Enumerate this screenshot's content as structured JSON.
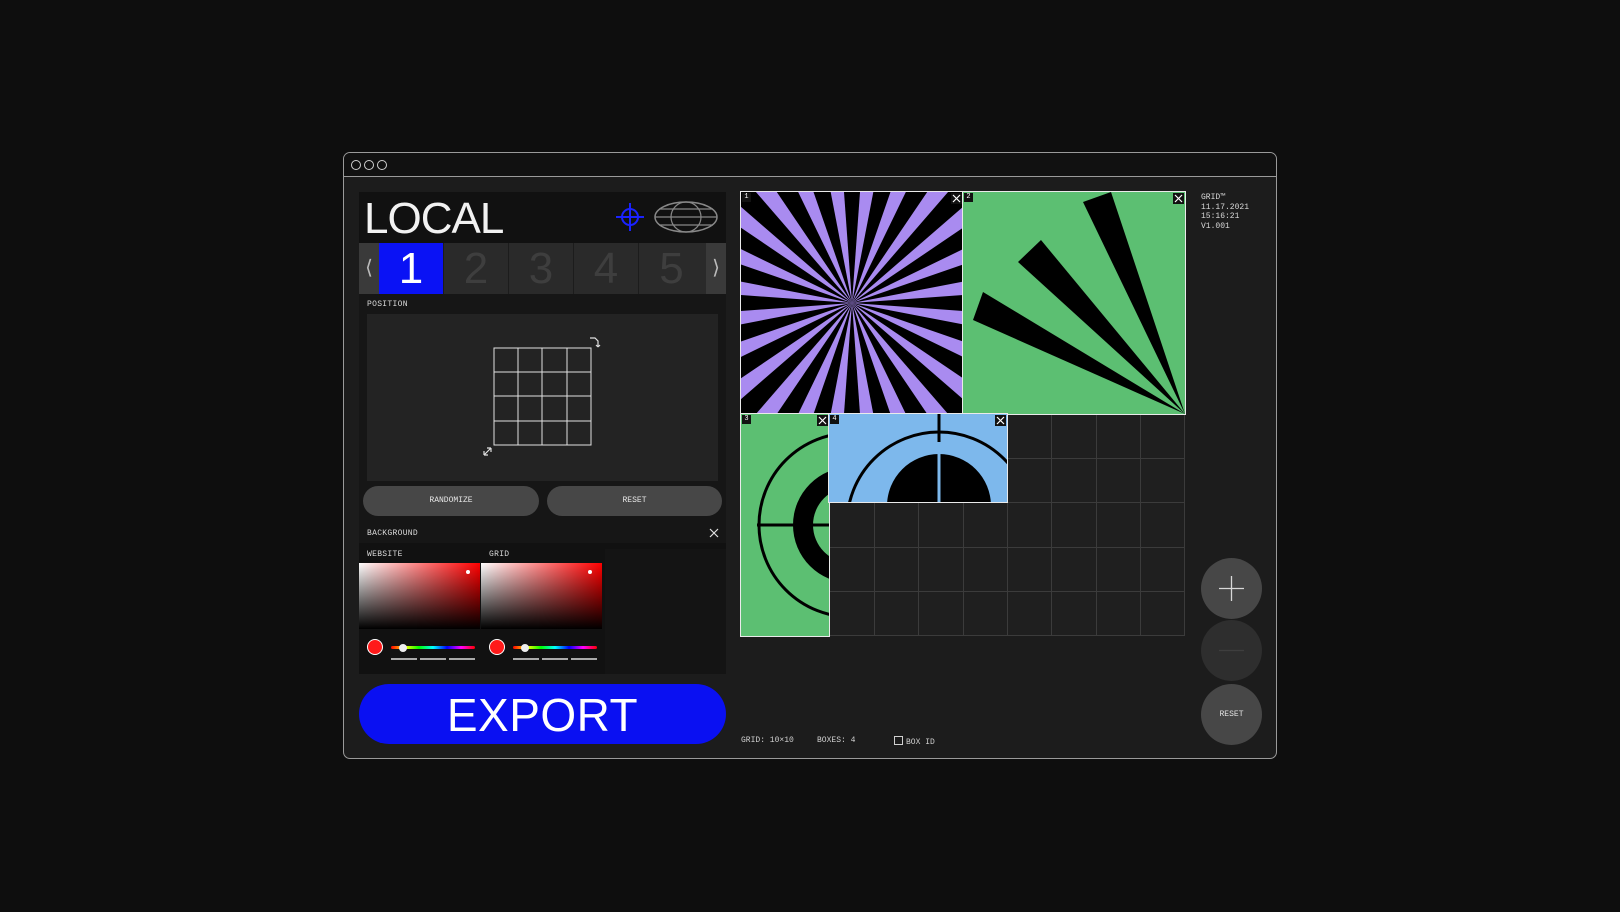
{
  "window": {
    "controls": [
      "close",
      "minimize",
      "maximize"
    ]
  },
  "header": {
    "title": "LOCAL",
    "icons": [
      "crosshair-icon",
      "globe-icon"
    ],
    "accent_color": "#0a12f5"
  },
  "tabs": {
    "prev_label": "⟨",
    "next_label": "⟩",
    "items": [
      {
        "label": "1",
        "active": true
      },
      {
        "label": "2",
        "active": false
      },
      {
        "label": "3",
        "active": false
      },
      {
        "label": "4",
        "active": false
      },
      {
        "label": "5",
        "active": false
      }
    ]
  },
  "position": {
    "label": "POSITION",
    "randomize_label": "RANDOMIZE",
    "reset_label": "RESET"
  },
  "background": {
    "label": "BACKGROUND",
    "website_label": "WEBSITE",
    "grid_label": "GRID",
    "website_color": "#ff0000",
    "grid_color": "#ff0000"
  },
  "export_label": "EXPORT",
  "meta": {
    "app": "GRID™",
    "date": "11.17.2021",
    "time": "15:16:21",
    "version": "V1.001"
  },
  "boxes": [
    {
      "id": "1",
      "bg": "#a98bf0",
      "pattern": "starburst"
    },
    {
      "id": "2",
      "bg": "#5cbf72",
      "pattern": "fan"
    },
    {
      "id": "3",
      "bg": "#5cbf72",
      "pattern": "rings"
    },
    {
      "id": "4",
      "bg": "#7db8ec",
      "pattern": "arch"
    }
  ],
  "controls": {
    "add_icon": "plus-icon",
    "remove_icon": "minus-icon",
    "reset_label": "RESET"
  },
  "status": {
    "grid": "GRID: 10×10",
    "boxes": "BOXES: 4",
    "box_id_label": "BOX ID"
  }
}
